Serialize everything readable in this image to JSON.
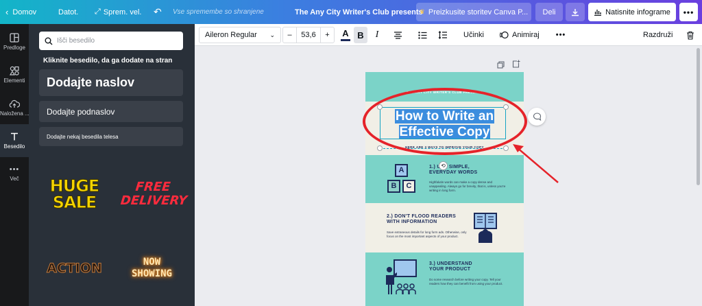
{
  "topbar": {
    "home": "Domov",
    "file": "Datot.",
    "resize": "Sprem. vel.",
    "save_status": "Vse spremembe so shranjene",
    "doc_title": "The Any City Writer's Club presents",
    "trial": "Preizkusite storitev Canva P...",
    "share": "Deli",
    "print": "Natisnite infograme"
  },
  "rail": [
    {
      "label": "Predloge",
      "icon": "template-icon"
    },
    {
      "label": "Elementi",
      "icon": "elements-icon"
    },
    {
      "label": "Naložena ...",
      "icon": "upload-icon"
    },
    {
      "label": "Besedilo",
      "icon": "text-icon"
    },
    {
      "label": "Več",
      "icon": "more-icon"
    }
  ],
  "panel": {
    "search_placeholder": "Išči besedilo",
    "hint": "Kliknite besedilo, da ga dodate na stran",
    "add_heading": "Dodajte naslov",
    "add_subheading": "Dodajte podnaslov",
    "add_body": "Dodajte nekaj besedila telesa",
    "presets": [
      "HUGE SALE",
      "FREE DELIVERY",
      "ACTION",
      "NOW SHOWING"
    ]
  },
  "format": {
    "font": "Aileron Regular",
    "size": "53,6",
    "minus": "–",
    "plus": "+",
    "text_color_glyph": "A",
    "bold_glyph": "B",
    "italic_glyph": "I",
    "effects": "Učinki",
    "animate": "Animiraj",
    "ungroup": "Razdruži"
  },
  "design": {
    "club": "THE ANY CITY WRITER'S CLUB PRESENTS",
    "title_line1": "How to Write an",
    "title_line2": "Effective Copy",
    "subtitle": "HERE ARE 3 WAYS TO IMPROVE YOUR COPY",
    "tip1_title_a": "1.) USE SIMPLE,",
    "tip1_title_b": "EVERYDAY WORDS",
    "tip1_body": "Highfalutin words can make a copy dense and unappealing. Always go for brevity, that is, unless you're writing in long form.",
    "tip2_title_a": "2.) DON'T FLOOD READERS",
    "tip2_title_b": "WITH INFORMATION",
    "tip2_body": "Save extraneous details for long form ads. Otherwise, only focus on the most important aspects of your product.",
    "tip3_title_a": "3.) UNDERSTAND",
    "tip3_title_b": "YOUR PRODUCT",
    "tip3_body": "Do some research before writing your copy. Tell your readers how they can benefit from using your product.",
    "block_a": "A",
    "block_b": "B",
    "block_c": "C"
  },
  "colors": {
    "accent": "#7bd3c8",
    "navy": "#1c2a59",
    "annotation": "#e5232a",
    "selection": "#3b8dde"
  }
}
